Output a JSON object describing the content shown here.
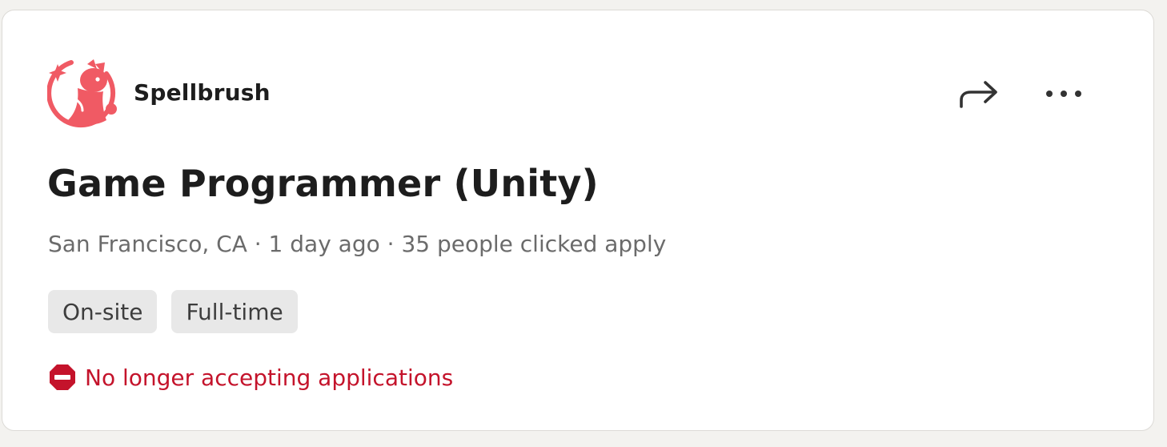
{
  "company": {
    "name": "Spellbrush",
    "logo_icon": "spellbrush-logo-icon",
    "brand_color": "#f05a64"
  },
  "actions": {
    "share_icon": "share-arrow-icon",
    "more_icon": "more-horizontal-icon"
  },
  "job": {
    "title": "Game Programmer (Unity)",
    "meta": "San Francisco, CA · 1 day ago · 35 people clicked apply",
    "tags": [
      "On-site",
      "Full-time"
    ]
  },
  "status": {
    "text": "No longer accepting applications",
    "icon": "no-entry-icon",
    "color": "#c4132b"
  }
}
